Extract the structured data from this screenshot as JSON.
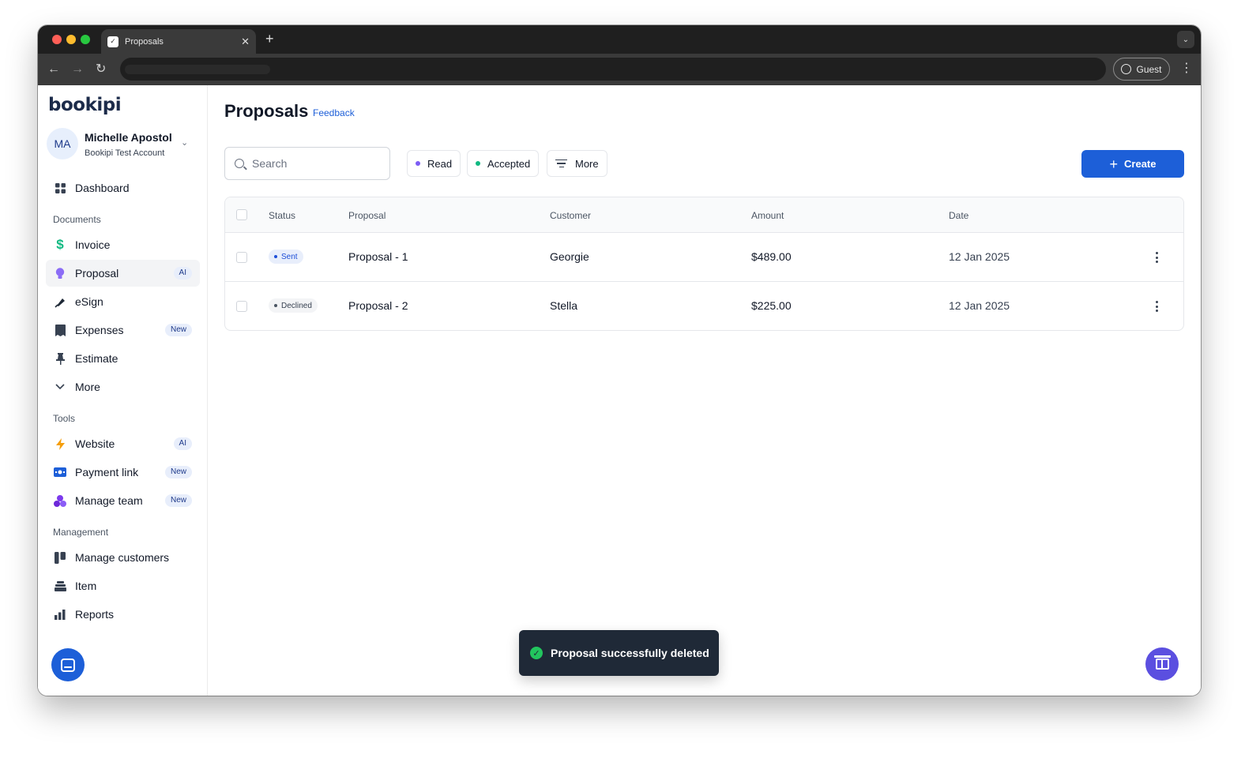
{
  "browser": {
    "tab_title": "Proposals",
    "guest_label": "Guest"
  },
  "sidebar": {
    "logo": "bookipi",
    "account": {
      "initials": "MA",
      "name": "Michelle Apostol",
      "subtitle": "Bookipi Test Account"
    },
    "dashboard": "Dashboard",
    "sections": {
      "documents": "Documents",
      "tools": "Tools",
      "management": "Management"
    },
    "documents": [
      {
        "label": "Invoice",
        "icon": "dollar-icon",
        "badge": ""
      },
      {
        "label": "Proposal",
        "icon": "bulb-icon",
        "badge": "AI"
      },
      {
        "label": "eSign",
        "icon": "pen-icon",
        "badge": ""
      },
      {
        "label": "Expenses",
        "icon": "receipt-icon",
        "badge": "New"
      },
      {
        "label": "Estimate",
        "icon": "pin-icon",
        "badge": ""
      },
      {
        "label": "More",
        "icon": "chevron-down-icon",
        "badge": ""
      }
    ],
    "tools": [
      {
        "label": "Website",
        "icon": "bolt-icon",
        "badge": "AI"
      },
      {
        "label": "Payment link",
        "icon": "payment-icon",
        "badge": "New"
      },
      {
        "label": "Manage team",
        "icon": "team-icon",
        "badge": "New"
      }
    ],
    "management": [
      {
        "label": "Manage customers",
        "icon": "customers-icon"
      },
      {
        "label": "Item",
        "icon": "item-icon"
      },
      {
        "label": "Reports",
        "icon": "bar-chart-icon"
      }
    ]
  },
  "header": {
    "title": "Proposals",
    "feedback": "Feedback"
  },
  "toolbar": {
    "search_placeholder": "Search",
    "filters": [
      {
        "label": "Read",
        "color": "#7c5cf4"
      },
      {
        "label": "Accepted",
        "color": "#10b981"
      }
    ],
    "more": "More",
    "create": "Create"
  },
  "table": {
    "columns": [
      "Status",
      "Proposal",
      "Customer",
      "Amount",
      "Date"
    ],
    "rows": [
      {
        "status": "Sent",
        "proposal": "Proposal - 1",
        "customer": "Georgie",
        "amount": "$489.00",
        "date": "12 Jan 2025"
      },
      {
        "status": "Declined",
        "proposal": "Proposal - 2",
        "customer": "Stella",
        "amount": "$225.00",
        "date": "12 Jan 2025"
      }
    ]
  },
  "toast": {
    "message": "Proposal successfully deleted"
  },
  "colors": {
    "accent": "#1d5fd8",
    "sent_badge_bg": "#e8eefb",
    "sent_badge_text": "#1d4ed8",
    "declined_badge_bg": "#f3f4f6",
    "declined_badge_text": "#374151"
  }
}
